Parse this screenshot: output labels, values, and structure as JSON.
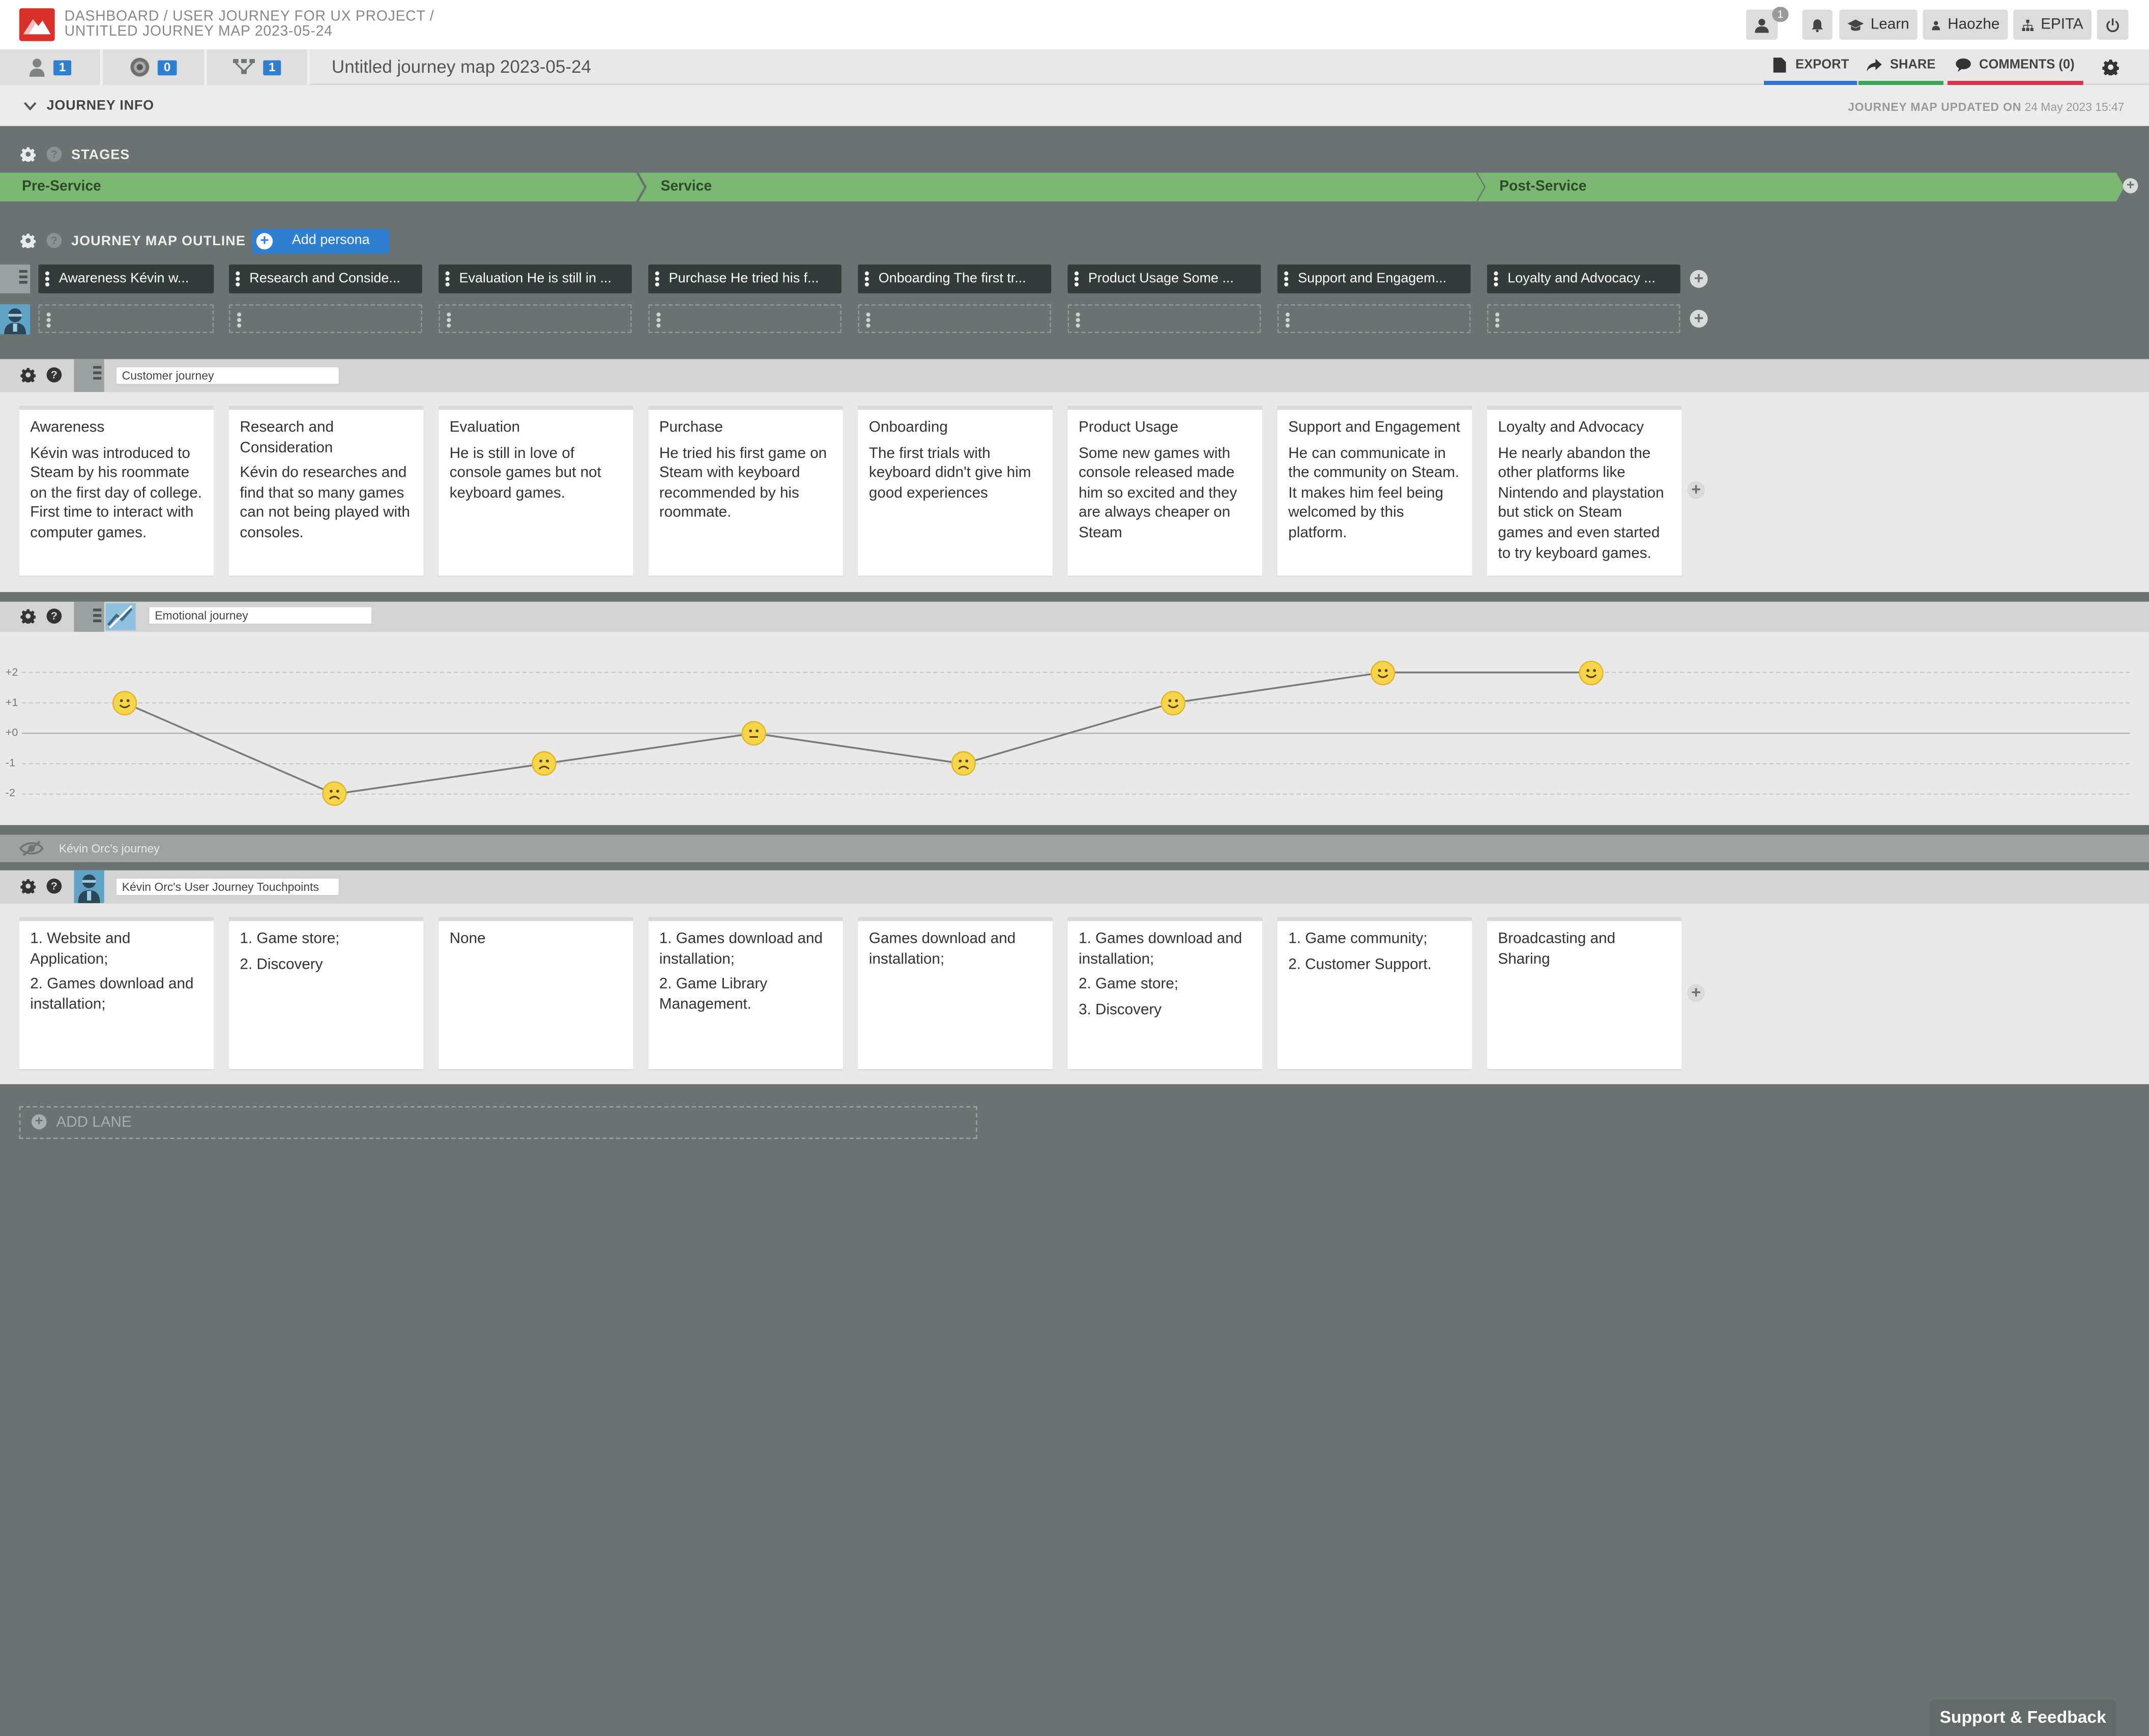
{
  "header": {
    "breadcrumb": [
      "DASHBOARD",
      "/",
      "USER JOURNEY FOR UX PROJECT",
      "/"
    ],
    "subtitle": "UNTITLED JOURNEY MAP 2023-05-24",
    "user_badge": "1",
    "learn_label": "Learn",
    "user_label": "Haozhe",
    "org_label": "EPITA",
    "icons": [
      "logo-icon",
      "user-icon",
      "bell-icon",
      "graduation-cap-icon",
      "person-icon",
      "sitemap-icon",
      "power-icon"
    ]
  },
  "toolbar": {
    "counters": [
      "1",
      "0",
      "1"
    ],
    "map_title": "Untitled journey map 2023-05-24",
    "export_label": "EXPORT",
    "share_label": "SHARE",
    "comments_label": "COMMENTS (0)",
    "accent_colors": {
      "export": "#2f6fd6",
      "share": "#3aa655",
      "comments": "#d6334a"
    }
  },
  "journey_info": {
    "label": "JOURNEY INFO",
    "updated_prefix": "JOURNEY MAP UPDATED ON",
    "updated_value": "24 May 2023 15:47"
  },
  "stages": {
    "label": "STAGES",
    "items": [
      "Pre-Service",
      "Service",
      "Post-Service"
    ],
    "color": "#7bb972"
  },
  "outline": {
    "label": "JOURNEY MAP OUTLINE",
    "add_persona": "Add persona",
    "chips": [
      "Awareness Kévin w...",
      "Research and Conside...",
      "Evaluation He is still in ...",
      "Purchase He tried his f...",
      "Onboarding The first tr...",
      "Product Usage Some ...",
      "Support and Engagem...",
      "Loyalty and Advocacy ..."
    ]
  },
  "customer_lane": {
    "label": "Customer journey",
    "cards": [
      {
        "title": "Awareness",
        "text": "Kévin was introduced to Steam by his roommate on the first day of college. First time to interact with computer games."
      },
      {
        "title": "Research and Consideration",
        "text": "Kévin do researches and find that so many games can not being played with consoles."
      },
      {
        "title": "Evaluation",
        "text": "He is still in love of console games but not keyboard games."
      },
      {
        "title": "Purchase",
        "text": "He tried his first game on Steam with keyboard recommended by his roommate."
      },
      {
        "title": "Onboarding",
        "text": "The first trials with keyboard didn't give him good experiences"
      },
      {
        "title": "Product Usage",
        "text": "Some new games with console released made him so excited and they are always cheaper on Steam"
      },
      {
        "title": "Support and Engagement",
        "text": "He can communicate in the community on Steam. It makes him feel being welcomed by this platform."
      },
      {
        "title": "Loyalty and Advocacy",
        "text": "He nearly abandon the other platforms like Nintendo and playstation but stick on Steam games and even started to try keyboard games."
      }
    ]
  },
  "emotional_lane": {
    "label": "Emotional journey",
    "y_labels": [
      "+2",
      "+1",
      "+0",
      "-1",
      "-2"
    ],
    "scores": [
      1,
      -2,
      -1,
      0,
      -1,
      1,
      2,
      2
    ],
    "faces": [
      "happy",
      "sad",
      "sad",
      "neutral",
      "sad",
      "happy",
      "happy",
      "happy"
    ]
  },
  "hidden_lane": {
    "label": "Kévin Orc's journey",
    "icon": "eye-slash-icon"
  },
  "touchpoints_lane": {
    "label": "Kévin Orc's User Journey Touchpoints",
    "cards": [
      [
        "1. Website and Application;",
        "2. Games download and installation;"
      ],
      [
        "1. Game store;",
        "2. Discovery"
      ],
      [
        "None"
      ],
      [
        "1. Games download and installation;",
        "2. Game Library Management."
      ],
      [
        "Games download and installation;"
      ],
      [
        "1. Games download and installation;",
        "2. Game store;",
        "3. Discovery"
      ],
      [
        "1. Game community;",
        "2. Customer Support."
      ],
      [
        "Broadcasting and Sharing"
      ]
    ]
  },
  "add_lane": "ADD LANE",
  "support": "Support & Feedback"
}
